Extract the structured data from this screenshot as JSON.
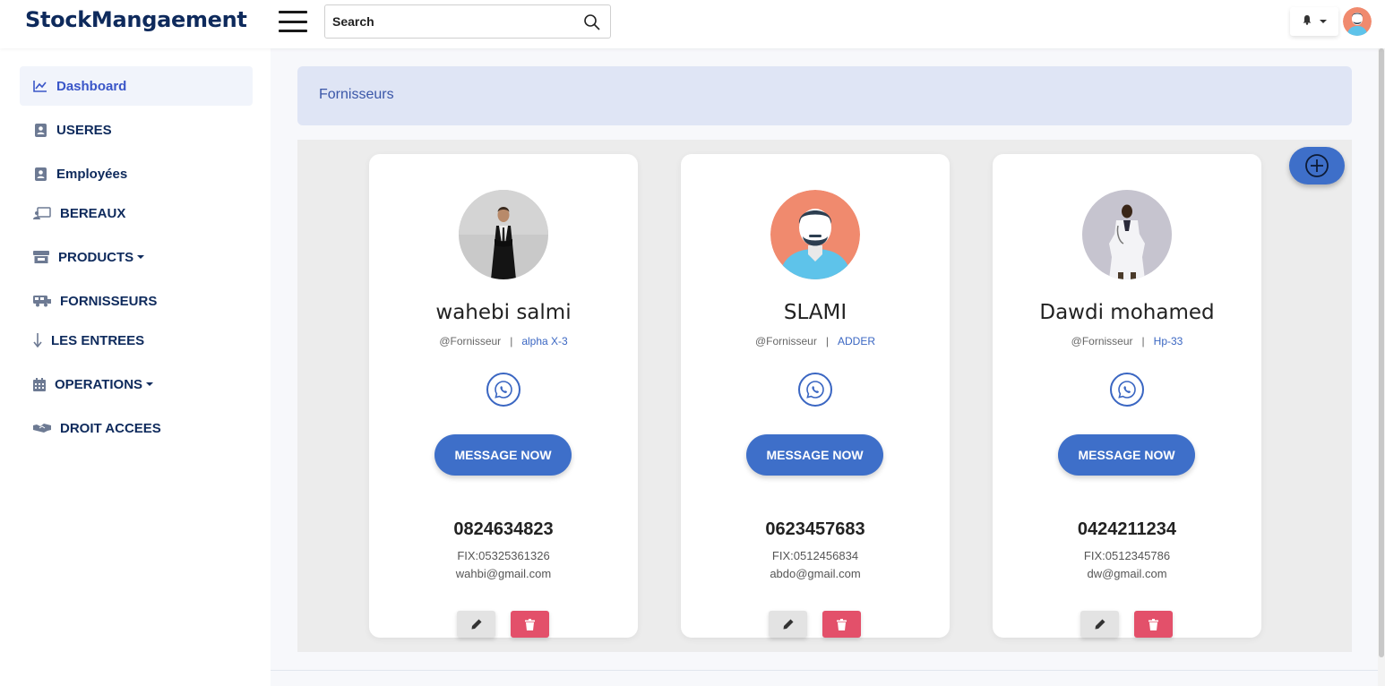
{
  "app": {
    "brand": "StockMangaement"
  },
  "search": {
    "placeholder": "Search"
  },
  "sidebar": {
    "items": [
      {
        "label": "Dashboard",
        "icon": "chart-line-icon",
        "active": true
      },
      {
        "label": "USERES",
        "icon": "user-badge-icon"
      },
      {
        "label": "Employées",
        "icon": "user-badge-icon"
      },
      {
        "label": "BEREAUX",
        "icon": "desk-icon"
      },
      {
        "label": "PRODUCTS",
        "icon": "store-icon",
        "dropdown": true
      },
      {
        "label": "FORNISSEURS",
        "icon": "truck-icon"
      },
      {
        "label": "LES ENTREES",
        "icon": "arrow-down-icon"
      },
      {
        "label": "OPERATIONS",
        "icon": "calendar-icon",
        "dropdown": true
      },
      {
        "label": "DROIT ACCEES",
        "icon": "handshake-icon"
      }
    ]
  },
  "page": {
    "title": "Fornisseurs"
  },
  "cards": [
    {
      "name": "wahebi salmi",
      "role": "@Fornisseur",
      "code": "alpha X-3",
      "button": "MESSAGE NOW",
      "phone": "0824634823",
      "fix": "FIX:05325361326",
      "email": "wahbi@gmail.com"
    },
    {
      "name": "SLAMI",
      "role": "@Fornisseur",
      "code": "ADDER",
      "button": "MESSAGE NOW",
      "phone": "0623457683",
      "fix": "FIX:0512456834",
      "email": "abdo@gmail.com"
    },
    {
      "name": "Dawdi mohamed",
      "role": "@Fornisseur",
      "code": "Hp-33",
      "button": "MESSAGE NOW",
      "phone": "0424211234",
      "fix": "FIX:0512345786",
      "email": "dw@gmail.com"
    }
  ],
  "colors": {
    "brand": "#0e2a5c",
    "accent": "#3e6fc9",
    "danger": "#e3506a",
    "header_band": "#dfe5f5"
  }
}
